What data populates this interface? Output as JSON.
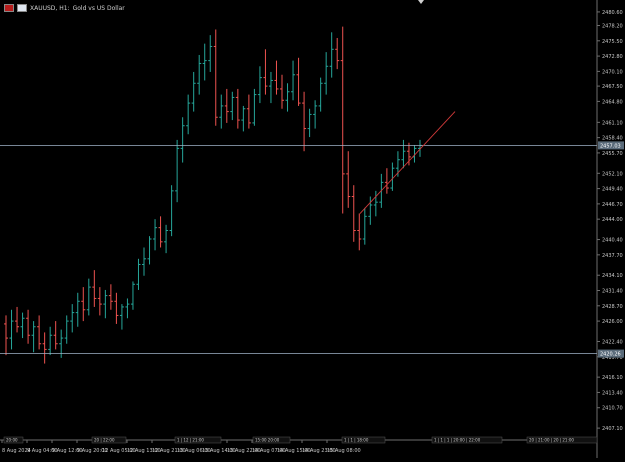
{
  "header": {
    "symbol": "XAUUSD, H1:",
    "description": "Gold vs US Dollar"
  },
  "price_axis": {
    "ticks": [
      "2480.60",
      "2478.20",
      "2475.50",
      "2472.80",
      "2470.10",
      "2467.50",
      "2464.80",
      "2461.10",
      "2458.40",
      "2455.70",
      "2452.10",
      "2449.40",
      "2446.70",
      "2444.00",
      "2440.40",
      "2437.70",
      "2434.10",
      "2431.40",
      "2428.70",
      "2426.00",
      "2422.40",
      "2419.70",
      "2416.10",
      "2413.40",
      "2410.70",
      "2407.10"
    ],
    "current_price_label": "2457.03",
    "lower_line_label": "2420.26",
    "range": [
      2405.0,
      2482.0
    ]
  },
  "time_axis": {
    "labels": [
      "8 Aug 2024",
      "9 Aug 04:00",
      "9 Aug 12:00",
      "9 Aug 20:00",
      "12 Aug 05:00",
      "12 Aug 13:00",
      "12 Aug 21:00",
      "13 Aug 06:00",
      "13 Aug 14:00",
      "13 Aug 22:00",
      "14 Aug 07:00",
      "14 Aug 15:00",
      "14 Aug 23:00",
      "15 Aug 08:00"
    ],
    "period_marks": [
      "20:00",
      "20 | 22:00",
      "1 | 12 | 21:00",
      "15:00 20:00",
      "1 | 1 | 18:00",
      "1 | 1 | 1 | 20:00 | 22:00",
      "20 | 21:00 | 20 | 21:00"
    ]
  },
  "chart_data": {
    "type": "bar",
    "style": "ohlc",
    "timeframe": "H1",
    "x": [
      "8 Aug 2024",
      "9 Aug 04:00",
      "9 Aug 12:00",
      "9 Aug 20:00",
      "12 Aug 05:00",
      "12 Aug 13:00",
      "12 Aug 21:00",
      "13 Aug 06:00",
      "13 Aug 14:00",
      "13 Aug 22:00",
      "14 Aug 07:00",
      "14 Aug 15:00",
      "14 Aug 23:00",
      "15 Aug 08:00"
    ],
    "series": [
      {
        "bars": [
          [
            2425.5,
            2427.0,
            2420.0,
            2423.0
          ],
          [
            2423.0,
            2428.0,
            2421.0,
            2426.0
          ],
          [
            2426.0,
            2428.5,
            2424.0,
            2425.0
          ],
          [
            2425.0,
            2427.5,
            2423.0,
            2426.5
          ],
          [
            2426.5,
            2428.0,
            2422.0,
            2423.5
          ],
          [
            2423.5,
            2426.0,
            2420.5,
            2425.0
          ],
          [
            2425.0,
            2427.0,
            2421.0,
            2422.0
          ],
          [
            2422.0,
            2424.0,
            2418.5,
            2421.0
          ],
          [
            2421.0,
            2425.0,
            2420.0,
            2423.5
          ],
          [
            2423.5,
            2426.0,
            2421.0,
            2422.0
          ],
          [
            2422.0,
            2424.5,
            2419.5,
            2423.0
          ],
          [
            2423.0,
            2427.0,
            2422.0,
            2426.0
          ],
          [
            2426.0,
            2429.0,
            2424.0,
            2427.5
          ],
          [
            2427.5,
            2431.0,
            2425.0,
            2429.5
          ],
          [
            2429.5,
            2432.0,
            2426.0,
            2428.0
          ],
          [
            2428.0,
            2433.5,
            2427.0,
            2432.0
          ],
          [
            2432.0,
            2435.0,
            2428.5,
            2430.0
          ],
          [
            2430.0,
            2432.0,
            2427.0,
            2429.0
          ],
          [
            2429.0,
            2431.5,
            2426.5,
            2430.5
          ],
          [
            2430.5,
            2432.5,
            2428.0,
            2429.5
          ],
          [
            2429.5,
            2431.0,
            2425.5,
            2427.0
          ],
          [
            2427.0,
            2429.0,
            2424.5,
            2428.5
          ],
          [
            2428.5,
            2430.0,
            2426.5,
            2429.0
          ],
          [
            2429.0,
            2433.0,
            2428.0,
            2432.5
          ],
          [
            2432.5,
            2437.0,
            2431.5,
            2436.0
          ],
          [
            2436.0,
            2439.0,
            2434.0,
            2437.0
          ],
          [
            2437.0,
            2441.0,
            2436.0,
            2440.5
          ],
          [
            2440.5,
            2444.0,
            2438.5,
            2442.5
          ],
          [
            2442.5,
            2444.5,
            2439.0,
            2440.0
          ],
          [
            2440.0,
            2443.0,
            2438.0,
            2442.0
          ],
          [
            2442.0,
            2450.0,
            2441.0,
            2449.0
          ],
          [
            2449.0,
            2458.0,
            2447.0,
            2456.5
          ],
          [
            2456.5,
            2462.0,
            2454.0,
            2460.5
          ],
          [
            2460.5,
            2466.0,
            2459.0,
            2464.5
          ],
          [
            2464.5,
            2470.0,
            2463.0,
            2468.0
          ],
          [
            2468.0,
            2473.0,
            2466.0,
            2471.5
          ],
          [
            2471.5,
            2475.0,
            2468.5,
            2472.0
          ],
          [
            2472.0,
            2476.5,
            2470.0,
            2474.5
          ],
          [
            2474.5,
            2477.5,
            2460.5,
            2462.0
          ],
          [
            2462.0,
            2466.0,
            2460.0,
            2464.0
          ],
          [
            2464.0,
            2467.0,
            2461.0,
            2463.0
          ],
          [
            2463.0,
            2466.5,
            2461.5,
            2465.5
          ],
          [
            2465.5,
            2467.0,
            2460.0,
            2461.5
          ],
          [
            2461.5,
            2464.0,
            2459.5,
            2463.5
          ],
          [
            2463.5,
            2466.0,
            2460.0,
            2461.0
          ],
          [
            2461.0,
            2467.0,
            2460.5,
            2466.0
          ],
          [
            2466.0,
            2471.0,
            2464.5,
            2469.0
          ],
          [
            2469.0,
            2474.0,
            2466.0,
            2467.5
          ],
          [
            2467.5,
            2470.0,
            2464.5,
            2468.5
          ],
          [
            2468.5,
            2472.0,
            2466.0,
            2467.0
          ],
          [
            2467.0,
            2469.5,
            2463.5,
            2465.0
          ],
          [
            2465.0,
            2468.0,
            2463.0,
            2466.5
          ],
          [
            2466.5,
            2472.0,
            2465.0,
            2469.5
          ],
          [
            2469.5,
            2472.5,
            2464.0,
            2464.5
          ],
          [
            2464.5,
            2466.5,
            2456.0,
            2460.0
          ],
          [
            2460.0,
            2463.5,
            2458.5,
            2462.5
          ],
          [
            2462.5,
            2465.0,
            2460.0,
            2464.0
          ],
          [
            2464.0,
            2469.0,
            2463.0,
            2468.0
          ],
          [
            2468.0,
            2473.5,
            2466.0,
            2471.0
          ],
          [
            2471.0,
            2477.0,
            2469.0,
            2474.0
          ],
          [
            2474.0,
            2476.0,
            2470.5,
            2472.0
          ],
          [
            2472.0,
            2478.0,
            2445.0,
            2452.0
          ],
          [
            2452.0,
            2456.0,
            2446.0,
            2448.0
          ],
          [
            2448.0,
            2450.0,
            2440.0,
            2442.0
          ],
          [
            2442.0,
            2445.0,
            2438.5,
            2440.5
          ],
          [
            2440.5,
            2446.0,
            2439.5,
            2444.5
          ],
          [
            2444.5,
            2448.0,
            2443.0,
            2446.5
          ],
          [
            2446.5,
            2449.0,
            2444.5,
            2447.0
          ],
          [
            2447.0,
            2452.0,
            2446.0,
            2450.5
          ],
          [
            2450.5,
            2453.0,
            2448.5,
            2449.5
          ],
          [
            2449.5,
            2454.0,
            2449.0,
            2453.0
          ],
          [
            2453.0,
            2456.0,
            2451.5,
            2454.5
          ],
          [
            2454.5,
            2458.0,
            2453.0,
            2456.0
          ],
          [
            2456.0,
            2457.5,
            2453.5,
            2455.0
          ],
          [
            2455.0,
            2457.0,
            2454.0,
            2456.5
          ],
          [
            2456.5,
            2458.0,
            2455.0,
            2457.03
          ]
        ]
      }
    ],
    "bull_color": "#26a69a",
    "bear_color": "#ef5350",
    "horizontal_lines": [
      2457.03,
      2420.26
    ],
    "trendline": {
      "from": [
        2441.0,
        2445.0
      ],
      "to": [
        2476.0,
        2463.0
      ]
    }
  },
  "colors": {
    "background": "#000000",
    "axis_text": "#c8c8c8",
    "hline": "#9fb3c8",
    "trendline": "#d23a3a",
    "label_bg": "#5a6b7a"
  }
}
